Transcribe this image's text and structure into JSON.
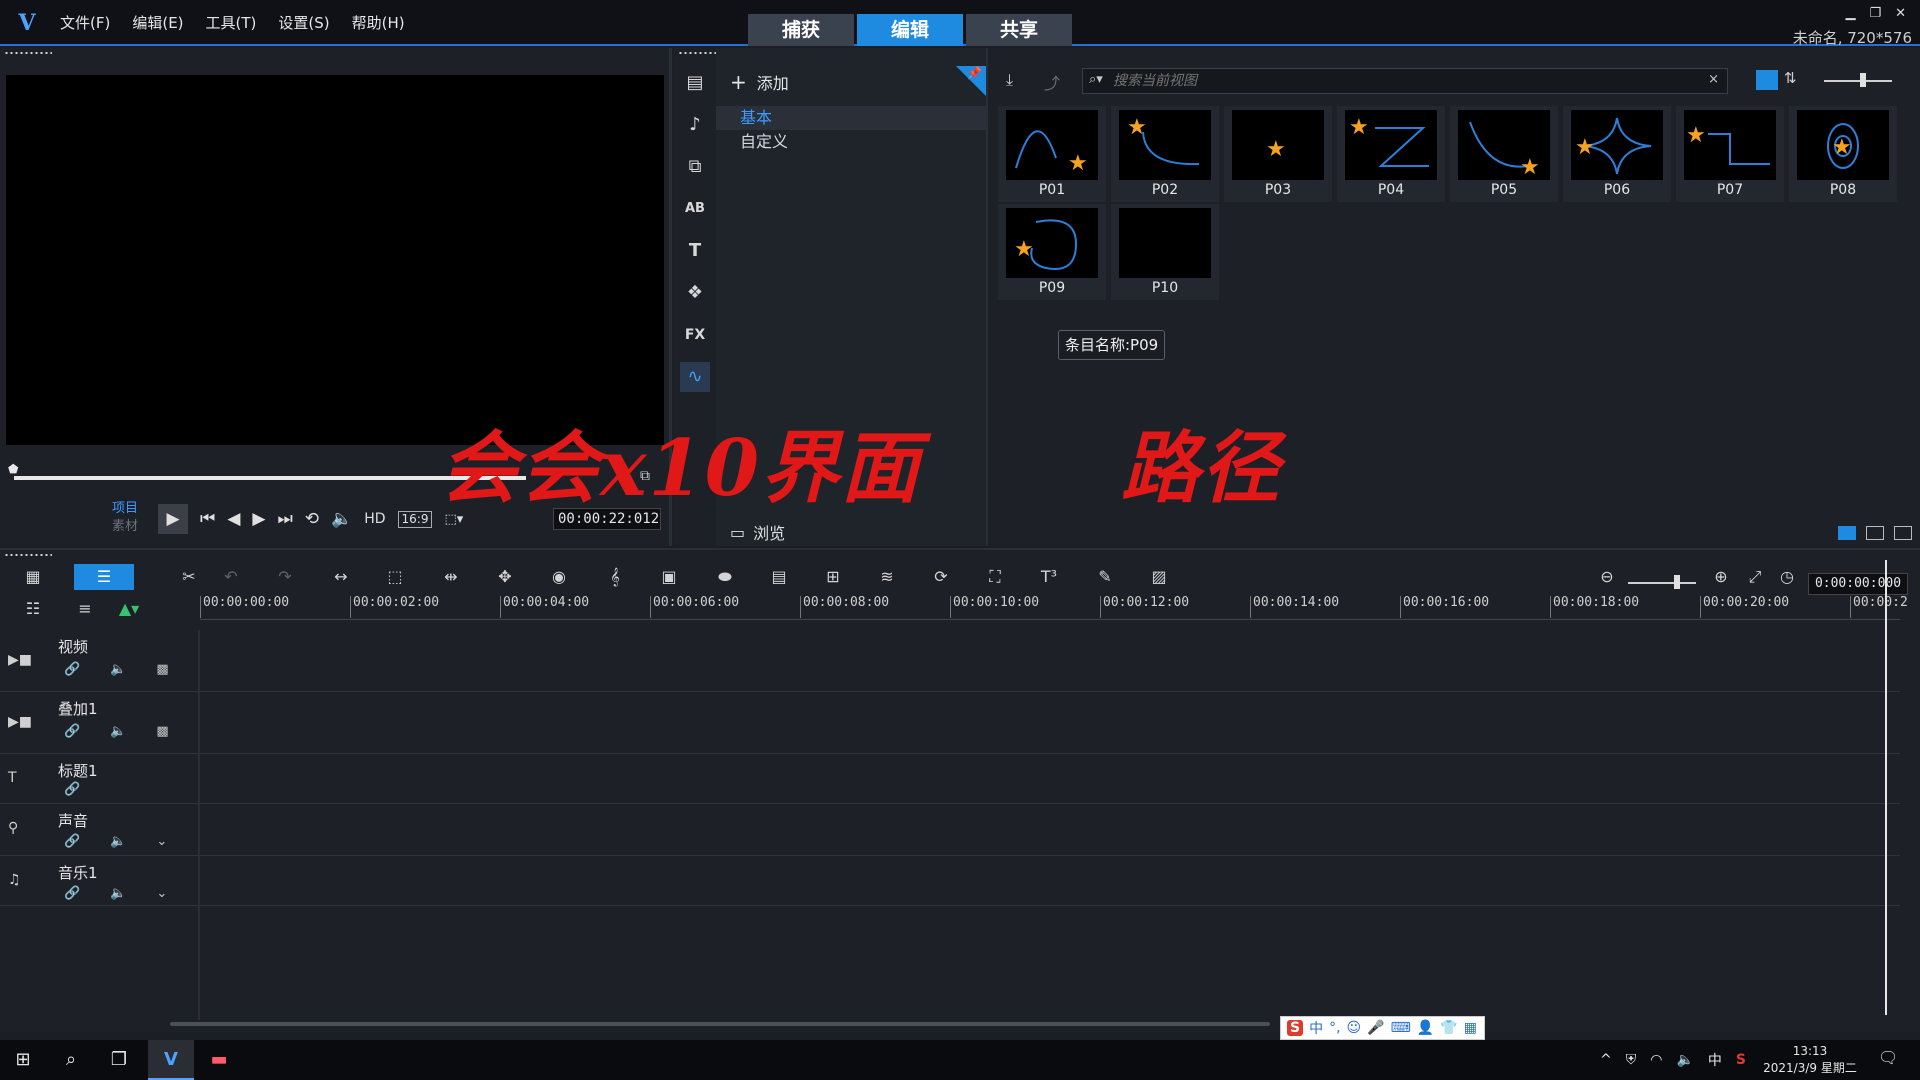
{
  "app": {
    "logo": "V",
    "menus": [
      "文件(F)",
      "编辑(E)",
      "工具(T)",
      "设置(S)",
      "帮助(H)"
    ],
    "mode_tabs": [
      "捕获",
      "编辑",
      "共享"
    ],
    "active_mode": "编辑",
    "project_info": "未命名, 720*576"
  },
  "preview": {
    "mode_project": "项目",
    "mode_clip": "素材",
    "hd_label": "HD",
    "aspect_label": "16:9",
    "timecode": "00:00:22:012"
  },
  "library": {
    "add_label": "添加",
    "categories": [
      "基本",
      "自定义"
    ],
    "selected_category": "基本",
    "browse_label": "浏览",
    "search_placeholder": "搜索当前视图",
    "thumbnails": [
      "P01",
      "P02",
      "P03",
      "P04",
      "P05",
      "P06",
      "P07",
      "P08",
      "P09",
      "P10"
    ],
    "tooltip": "条目名称:P09",
    "side_icons": [
      "media-icon",
      "instant-project-icon",
      "transition-icon",
      "title-icon",
      "text-icon",
      "graphics-icon",
      "filter-icon",
      "path-icon"
    ],
    "side_labels": {
      "title": "AB",
      "text": "T",
      "filter": "FX"
    }
  },
  "watermark": {
    "left": "会会x10界面",
    "right": "路径",
    "color": "#e01818"
  },
  "timeline": {
    "timecode": "0:00:00:000",
    "ruler": [
      "00:00:00:00",
      "00:00:02:00",
      "00:00:04:00",
      "00:00:06:00",
      "00:00:08:00",
      "00:00:10:00",
      "00:00:12:00",
      "00:00:14:00",
      "00:00:16:00",
      "00:00:18:00",
      "00:00:20:00",
      "00:00:2"
    ],
    "tracks": [
      {
        "name": "视频",
        "icon": "video-track-icon"
      },
      {
        "name": "叠加1",
        "icon": "overlay-track-icon"
      },
      {
        "name": "标题1",
        "icon": "title-track-icon"
      },
      {
        "name": "声音",
        "icon": "voice-track-icon"
      },
      {
        "name": "音乐1",
        "icon": "music-track-icon"
      }
    ]
  },
  "ime": {
    "label": "中"
  },
  "taskbar": {
    "time": "13:13",
    "date": "2021/3/9 星期二",
    "tray_lang": "中"
  },
  "colors": {
    "accent": "#1e8be0",
    "background": "#1d2027"
  }
}
